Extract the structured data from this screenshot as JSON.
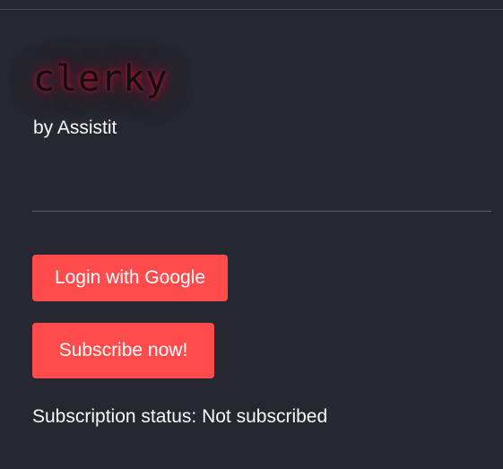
{
  "brand": {
    "logo_text": "clerky",
    "byline": "by Assistit"
  },
  "actions": {
    "login_label": "Login with Google",
    "subscribe_label": "Subscribe now!"
  },
  "status": {
    "text": "Subscription status: Not subscribed"
  },
  "colors": {
    "background": "#262730",
    "button": "#ff4b4b",
    "text": "#fafafa",
    "logo_glow": "#b4143c"
  }
}
